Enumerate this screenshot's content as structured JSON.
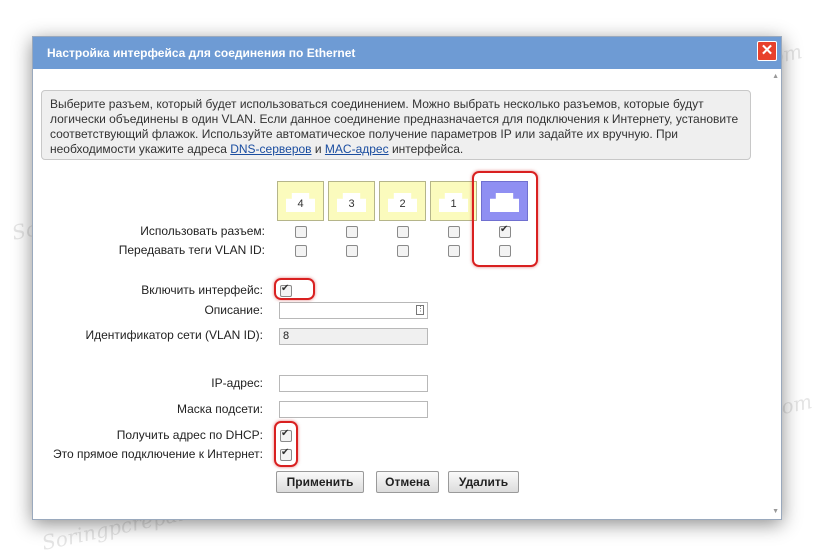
{
  "dialog": {
    "title": "Настройка интерфейса для соединения по Ethernet",
    "close": "✕"
  },
  "info": {
    "text_before": "Выберите разъем, который будет использоваться соединением. Можно выбрать несколько разъемов, которые будут логически объединены в один VLAN. Если данное соединение предназначается для подключения к Интернету, установите соответствующий флажок. Используйте автоматическое получение параметров IP или задайте их вручную. При необходимости укажите адреса ",
    "link_dns": "DNS-серверов",
    "and": " и ",
    "link_mac": "MAC-адрес",
    "text_after": " интерфейса."
  },
  "ports": [
    {
      "label": "4",
      "use": false,
      "vlan": false
    },
    {
      "label": "3",
      "use": false,
      "vlan": false
    },
    {
      "label": "2",
      "use": false,
      "vlan": false
    },
    {
      "label": "1",
      "use": false,
      "vlan": false
    },
    {
      "label": "",
      "use": true,
      "vlan": false,
      "active": true
    }
  ],
  "rows": {
    "use_port": "Использовать разъем:",
    "vlan_tags": "Передавать теги VLAN ID:"
  },
  "form": {
    "enable_label": "Включить интерфейс:",
    "enable_checked": true,
    "desc_label": "Описание:",
    "desc_value": "",
    "vlan_id_label": "Идентификатор сети (VLAN ID):",
    "vlan_id_value": "8",
    "ip_label": "IP-адрес:",
    "ip_value": "",
    "mask_label": "Маска подсети:",
    "mask_value": "",
    "dhcp_label": "Получить адрес по DHCP:",
    "dhcp_checked": true,
    "internet_label": "Это прямое подключение к Интернет:",
    "internet_checked": true
  },
  "buttons": {
    "apply": "Применить",
    "cancel": "Отмена",
    "delete": "Удалить"
  },
  "watermark": "Soringpcrepair.Com",
  "colors": {
    "titlebar": "#6e9bd4",
    "port": "#fbfbbd",
    "port_active": "#8f8ff2",
    "highlight": "#d92020"
  }
}
